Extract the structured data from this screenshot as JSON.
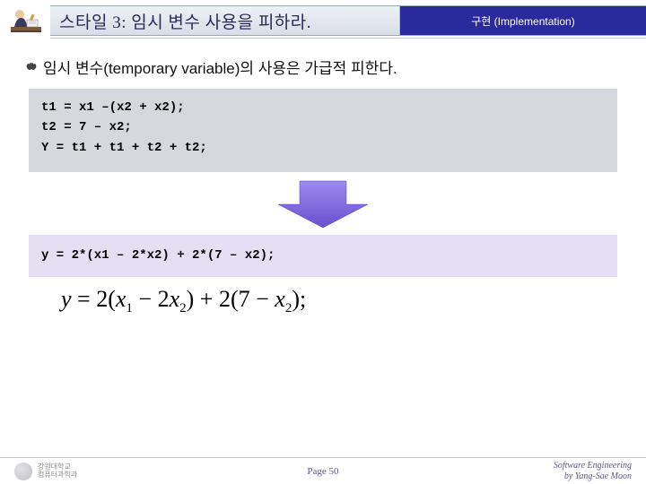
{
  "header": {
    "title": "스타일 3: 임시 변수 사용을 피하라.",
    "section": "구현 (Implementation)"
  },
  "content": {
    "bullet": "임시 변수(temporary variable)의 사용은 가급적 피한다.",
    "code1_line1": "t1 = x1 –(x2 + x2);",
    "code1_line2": "t2 = 7 – x2;",
    "code1_line3": "Y = t1 + t1 + t2 + t2;",
    "code2": "y = 2*(x1 – 2*x2) + 2*(7 – x2);"
  },
  "footer": {
    "logo_text1": "강원대학교",
    "logo_text2": "컴퓨터과학과",
    "page": "Page 50",
    "credit1": "Software Engineering",
    "credit2": "by Yang-Sae Moon"
  }
}
